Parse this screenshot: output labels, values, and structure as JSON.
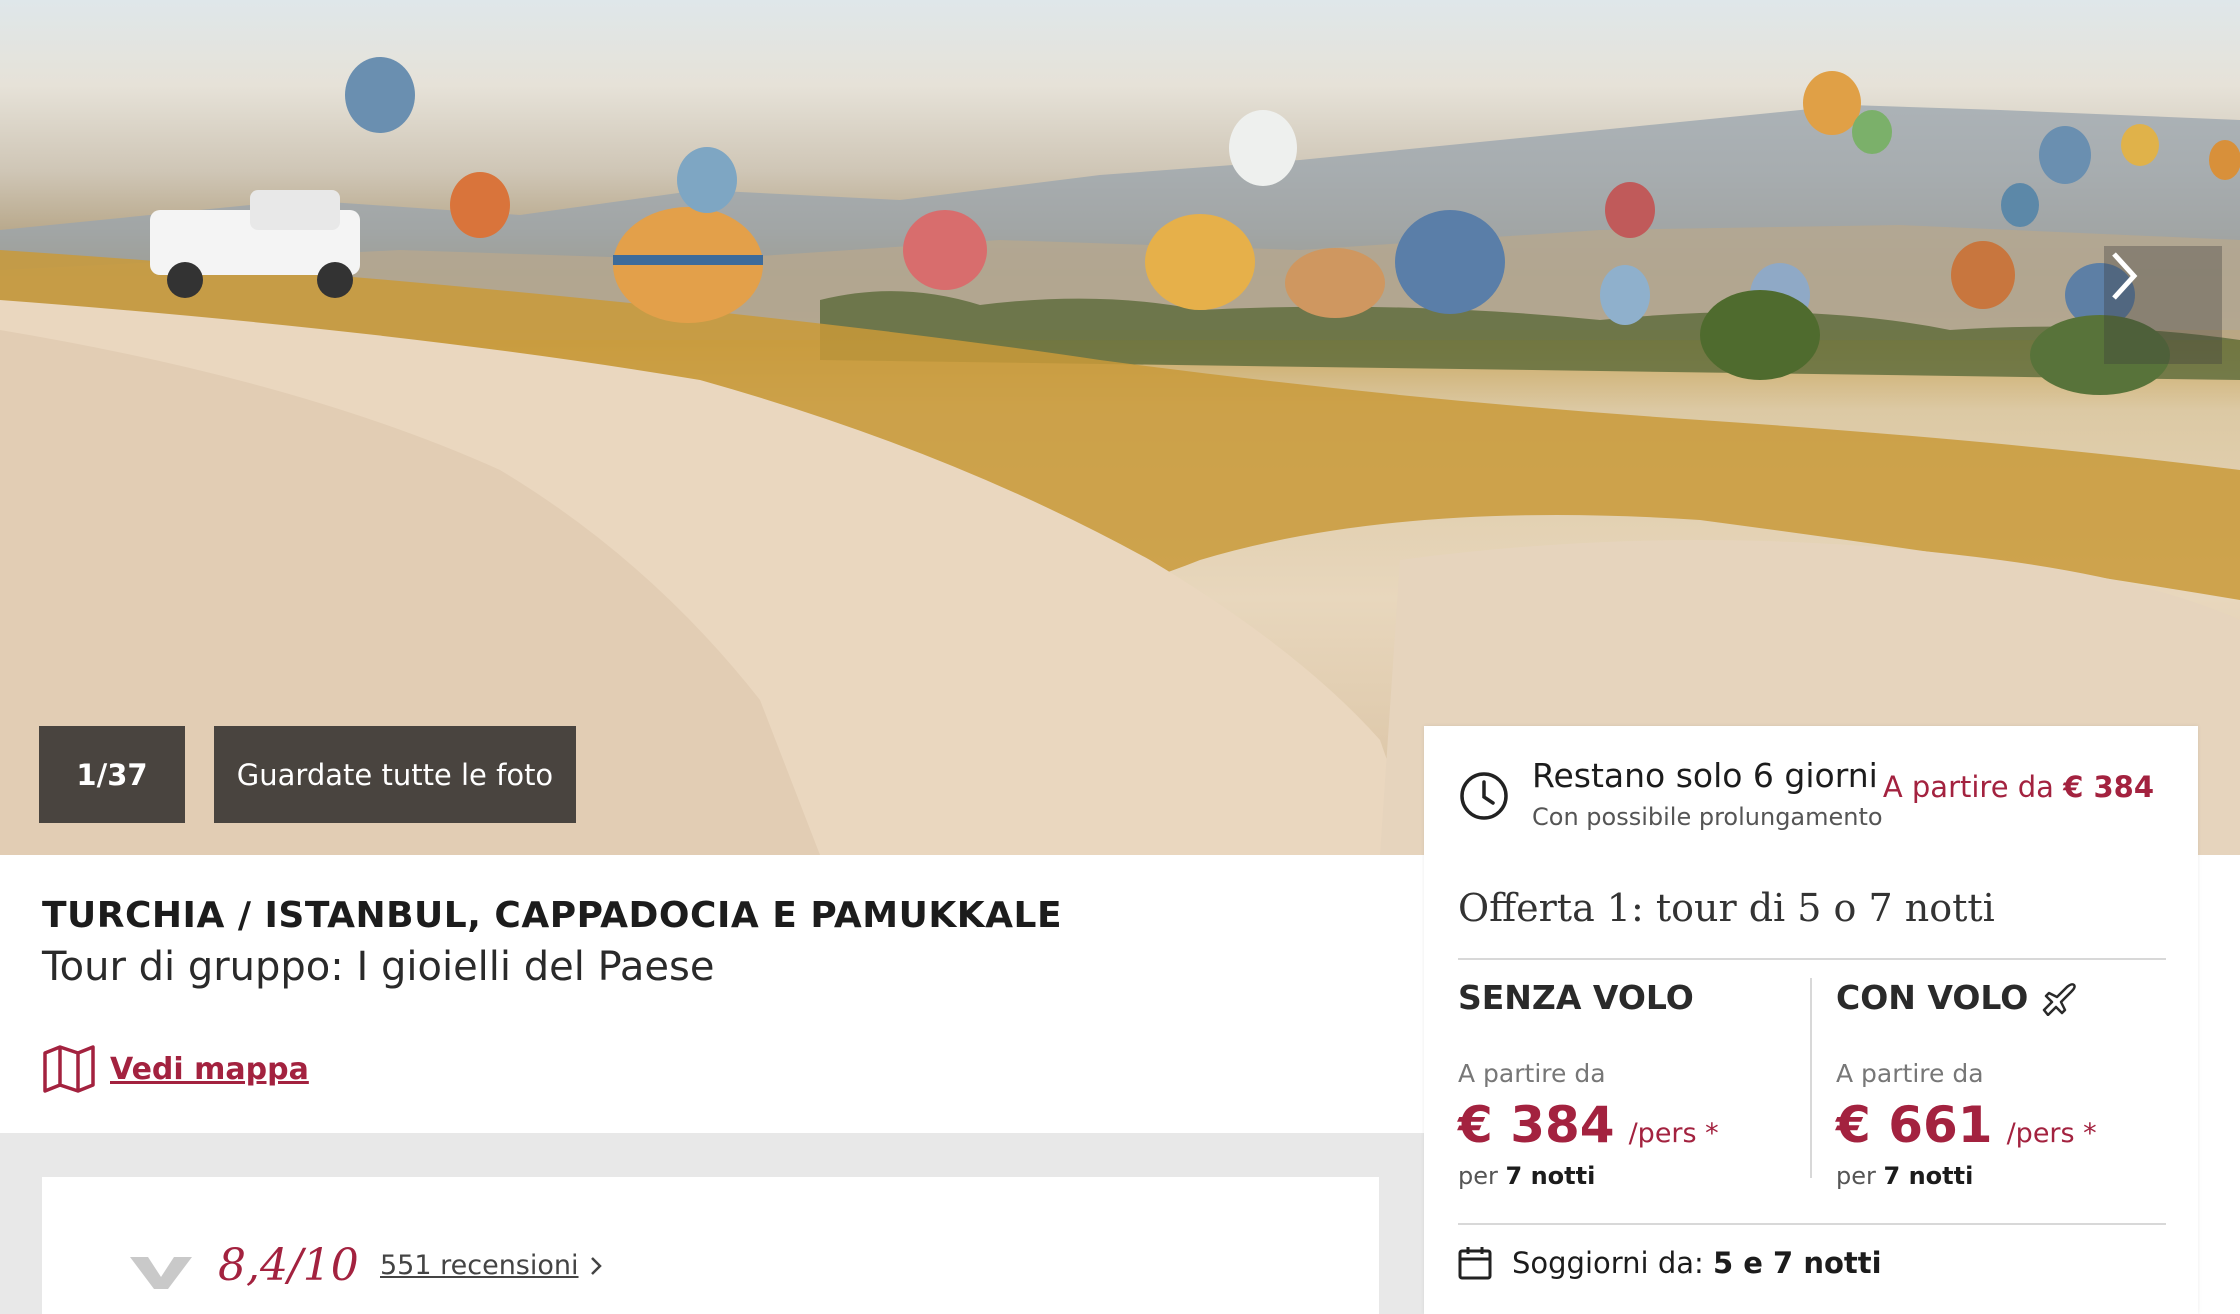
{
  "gallery": {
    "counter": "1/37",
    "all_photos_label": "Guardate tutte le foto",
    "next_icon": "chevron-right-icon"
  },
  "product": {
    "country": "TURCHIA / ISTANBUL, CAPPADOCIA E PAMUKKALE",
    "subtitle": "Tour di gruppo: I gioielli del Paese",
    "map_label": "Vedi mappa"
  },
  "reviews": {
    "score": "8,4/10",
    "count_label": "551 recensioni"
  },
  "offer_panel": {
    "deadline_title": "Restano solo 6 giorni",
    "deadline_sub": "Con possibile prolungamento",
    "from_prefix": "A partire da",
    "from_price": "€ 384",
    "offer_title": "Offerta 1: tour di 5 o 7 notti",
    "without_flight": {
      "heading": "SENZA VOLO",
      "from_label": "A partire da",
      "price": "€ 384",
      "unit": "/pers *",
      "nights_prefix": "per",
      "nights": "7 notti"
    },
    "with_flight": {
      "heading": "CON VOLO",
      "from_label": "A partire da",
      "price": "€ 661",
      "unit": "/pers *",
      "nights_prefix": "per",
      "nights": "7 notti"
    },
    "stay_label": "Soggiorni da:",
    "stay_value": "5 e 7 notti"
  },
  "colors": {
    "accent": "#a3223f",
    "text": "#1c1c1c",
    "band": "#e8e8e8"
  }
}
